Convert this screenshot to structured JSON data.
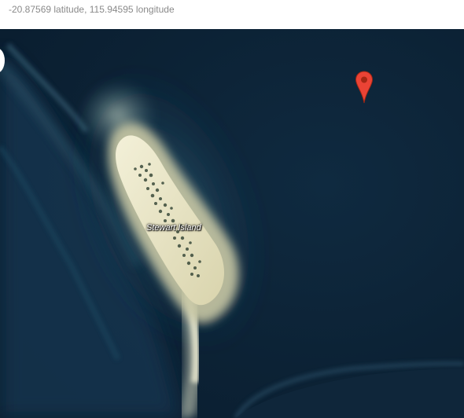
{
  "coordinates": {
    "text": "-20.87569 latitude, 115.94595 longitude"
  },
  "map": {
    "type": "satellite",
    "label": "Stewart Island",
    "marker_color": "#ea4335",
    "marker_icon": "map-pin-icon",
    "water_color": "#0d2538",
    "sand_color": "#e9e5c6"
  }
}
